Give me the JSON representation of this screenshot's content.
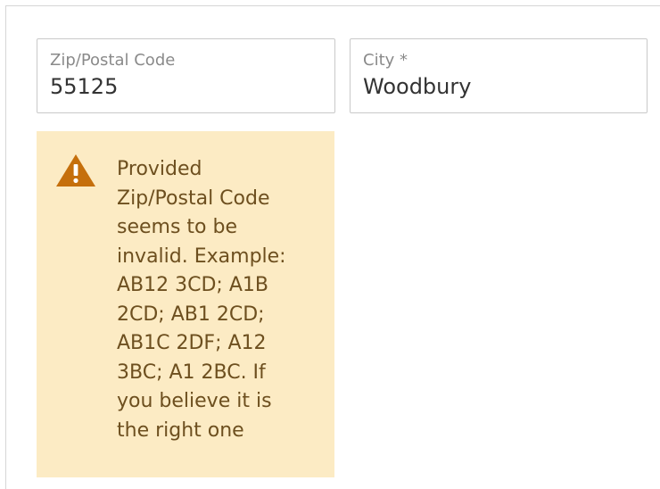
{
  "form": {
    "zip_field": {
      "label": "Zip/Postal Code",
      "value": "55125"
    },
    "city_field": {
      "label": "City *",
      "value": "Woodbury"
    },
    "warning": {
      "icon": "warning-triangle-icon",
      "message": "Provided\nZip/Postal Code\nseems to be\ninvalid. Example:\nAB12 3CD; A1B\n2CD; AB1 2CD;\nAB1C 2DF; A12\n3BC; A1 2BC. If\nyou believe it is\nthe right one",
      "background_color": "#fcebc4",
      "icon_color": "#c56f0c"
    }
  }
}
